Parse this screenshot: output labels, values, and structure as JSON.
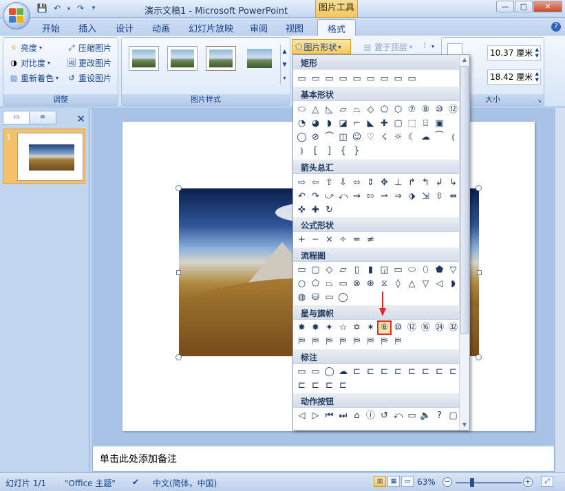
{
  "title_bar": {
    "title": "演示文稿1 - Microsoft PowerPoint",
    "context_tab": "图片工具",
    "minimize": "—",
    "maximize": "□",
    "close": "✕"
  },
  "tabs": [
    "开始",
    "插入",
    "设计",
    "动画",
    "幻灯片放映",
    "审阅",
    "视图",
    "格式"
  ],
  "active_tab": "格式",
  "ribbon": {
    "adjust": {
      "label": "调整",
      "brightness": "亮度",
      "contrast": "对比度",
      "recolor": "重新着色",
      "compress": "压缩图片",
      "change": "更改图片",
      "reset": "重设图片"
    },
    "styles": {
      "label": "图片样式"
    },
    "shape_button": "图片形状",
    "bring_front": "置于顶层",
    "size": {
      "label": "大小",
      "height": "10.37 厘米",
      "width": "18.42 厘米"
    }
  },
  "shape_gallery": {
    "categories": [
      "矩形",
      "基本形状",
      "箭头总汇",
      "公式形状",
      "流程图",
      "星与旗帜",
      "标注",
      "动作按钮"
    ],
    "rect_shapes": [
      "▭",
      "▭",
      "▭",
      "▭",
      "▭",
      "▭",
      "▭",
      "▭",
      "▭"
    ],
    "basic_1": [
      "⬭",
      "△",
      "◺",
      "▱",
      "⏢",
      "◇",
      "⬠",
      "⬡",
      "⑦",
      "⑧",
      "⑩",
      "⑫"
    ],
    "basic_2": [
      "◔",
      "◕",
      "◗",
      "◪",
      "⌐",
      "◣",
      "✚",
      "▢",
      "⬚",
      "⌸",
      "▣"
    ],
    "basic_3": [
      "◯",
      "⊘",
      "⌒",
      "◫",
      "☺",
      "♡",
      "☇",
      "☼",
      "☾",
      "☁",
      "⁀",
      "⦅"
    ],
    "basic_4": [
      "⦆",
      "[",
      "]",
      "{",
      "}"
    ],
    "arrow_1": [
      "⇨",
      "⇦",
      "⇧",
      "⇩",
      "⬄",
      "⇕",
      "✥",
      "⊥",
      "↱",
      "↰",
      "↲",
      "↳"
    ],
    "arrow_2": [
      "↶",
      "↷",
      "⤻",
      "⤺",
      "⇝",
      "⇰",
      "⇀",
      "⇒",
      "⬗",
      "⇲",
      "⇳",
      "⇴"
    ],
    "arrow_3": [
      "✜",
      "✚",
      "↻"
    ],
    "equation": [
      "+",
      "−",
      "×",
      "÷",
      "=",
      "≠"
    ],
    "flow_1": [
      "▭",
      "▢",
      "◇",
      "▱",
      "▯",
      "▮",
      "◲",
      "▭",
      "⬭",
      "⬯",
      "⬟",
      "▽"
    ],
    "flow_2": [
      "○",
      "⬠",
      "⏢",
      "▭",
      "⊗",
      "⊕",
      "⧖",
      "◊",
      "△",
      "▽",
      "◁",
      "◗"
    ],
    "flow_3": [
      "◍",
      "⛁",
      "▭",
      "◯"
    ],
    "stars_1": [
      "✸",
      "✹",
      "✦",
      "☆",
      "✡",
      "✶",
      "⑧",
      "⑩",
      "⑫",
      "⑯",
      "㉔",
      "㉜"
    ],
    "stars_2": [
      "⛿",
      "⛿",
      "⛿",
      "⛿",
      "⛿",
      "⛿",
      "⛿",
      "⛿"
    ],
    "callout_1": [
      "▭",
      "▭",
      "◯",
      "☁",
      "⊏",
      "⊏",
      "⊏",
      "⊏",
      "⊏",
      "⊏",
      "⊏",
      "⊏"
    ],
    "callout_2": [
      "⊏",
      "⊏",
      "⊏",
      "⊏"
    ],
    "action": [
      "◁",
      "▷",
      "⏮",
      "⏭",
      "⌂",
      "ⓘ",
      "↺",
      "⤺",
      "▭",
      "🔈",
      "?",
      "▢"
    ],
    "highlighted_shape": "⑧"
  },
  "left_pane": {
    "tab_slides": "▭",
    "tab_outline": "≡",
    "close": "✕",
    "slide_number": "1"
  },
  "notes_placeholder": "单击此处添加备注",
  "status": {
    "slide": "幻灯片 1/1",
    "theme": "\"Office 主题\"",
    "language": "中文(简体，中国)",
    "zoom": "63%"
  }
}
